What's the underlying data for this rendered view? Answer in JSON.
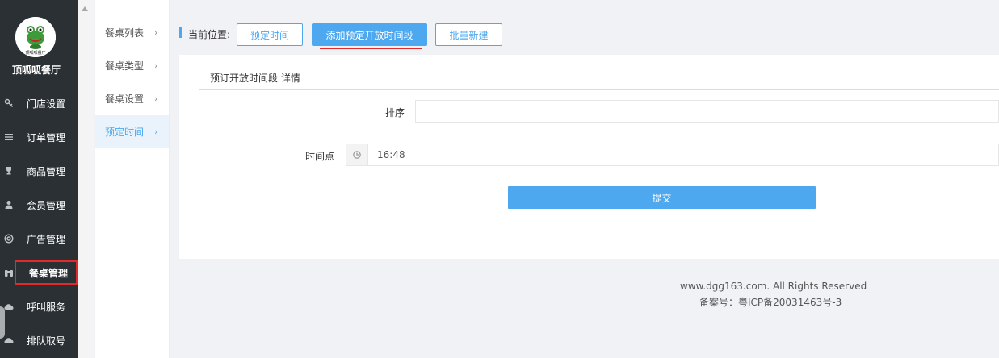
{
  "app": {
    "shop_name": "顶呱呱餐厅",
    "logo_icon": "frog-mascot-icon"
  },
  "sidebar": {
    "items": [
      {
        "label": "门店设置",
        "icon": "key-icon"
      },
      {
        "label": "订单管理",
        "icon": "list-icon"
      },
      {
        "label": "商品管理",
        "icon": "trophy-icon"
      },
      {
        "label": "会员管理",
        "icon": "user-icon"
      },
      {
        "label": "广告管理",
        "icon": "lifebuoy-icon"
      },
      {
        "label": "餐桌管理",
        "icon": "binoculars-icon"
      },
      {
        "label": "呼叫服务",
        "icon": "cloud-icon"
      },
      {
        "label": "排队取号",
        "icon": "cloud-icon"
      }
    ],
    "active_index": 5
  },
  "submenu": {
    "items": [
      {
        "label": "餐桌列表"
      },
      {
        "label": "餐桌类型"
      },
      {
        "label": "餐桌设置"
      },
      {
        "label": "预定时间"
      }
    ],
    "active_index": 3,
    "arrow": "›"
  },
  "toolbar": {
    "position_label": "当前位置:",
    "buttons": [
      {
        "label": "预定时间"
      },
      {
        "label": "添加预定开放时间段"
      },
      {
        "label": "批量新建"
      }
    ],
    "active_index": 1
  },
  "form": {
    "title": "预订开放时间段 详情",
    "sort_label": "排序",
    "sort_value": "",
    "time_label": "时间点",
    "time_value": "16:48",
    "time_icon": "clock-icon",
    "submit_label": "提交"
  },
  "footer": {
    "copyright": "www.dgg163.com. All Rights Reserved",
    "icp": "备案号：粤ICP备20031463号-3"
  },
  "colors": {
    "accent": "#4da8f0",
    "sidebar_bg": "#2b3035",
    "highlight_red": "#e12b2b"
  }
}
